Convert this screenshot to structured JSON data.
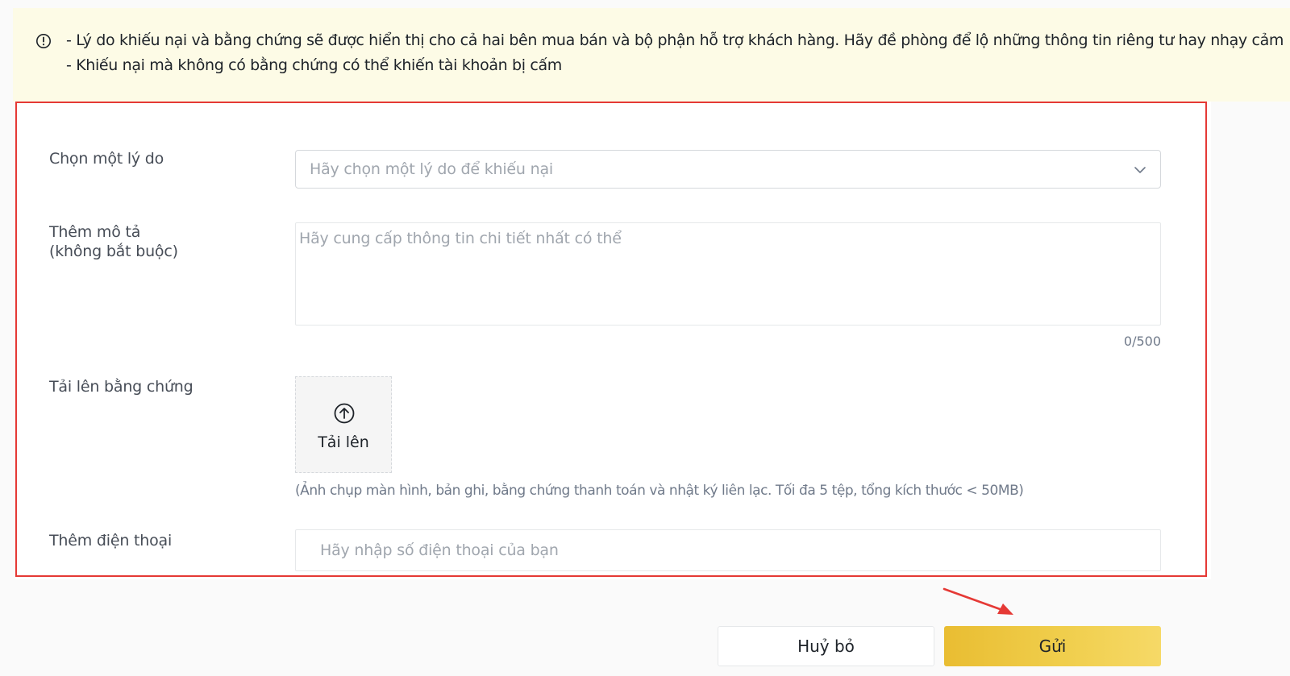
{
  "warning": {
    "icon": "info-circle-icon",
    "line1": "- Lý do khiếu nại và bằng chứng sẽ được hiển thị cho cả hai bên mua bán và bộ phận hỗ trợ khách hàng. Hãy đề phòng để lộ những thông tin riêng tư hay nhạy cảm",
    "line2": "- Khiếu nại mà không có bằng chứng có thể khiến tài khoản bị cấm",
    "background_color": "#fdfbe6"
  },
  "form": {
    "reason": {
      "label": "Chọn một lý do",
      "placeholder": "Hãy chọn một lý do để khiếu nại",
      "icon": "chevron-down-icon"
    },
    "description": {
      "label_line1": "Thêm mô tả",
      "label_line2": "(không bắt buộc)",
      "placeholder": "Hãy cung cấp thông tin chi tiết nhất có thể",
      "counter": "0/500"
    },
    "evidence": {
      "label": "Tải lên bằng chứng",
      "upload_label": "Tải lên",
      "upload_icon": "upload-arrow-icon",
      "hint": "(Ảnh chụp màn hình, bản ghi, bằng chứng thanh toán và nhật ký liên lạc. Tối đa 5 tệp, tổng kích thước < 50MB)"
    },
    "phone": {
      "label": "Thêm điện thoại",
      "placeholder": "Hãy nhập số điện thoại của bạn"
    }
  },
  "actions": {
    "cancel_label": "Huỷ bỏ",
    "submit_label": "Gửi",
    "submit_color": "#f0ce4c"
  },
  "annotations": {
    "highlight_color": "#e53935",
    "arrow_color": "#e53935"
  }
}
